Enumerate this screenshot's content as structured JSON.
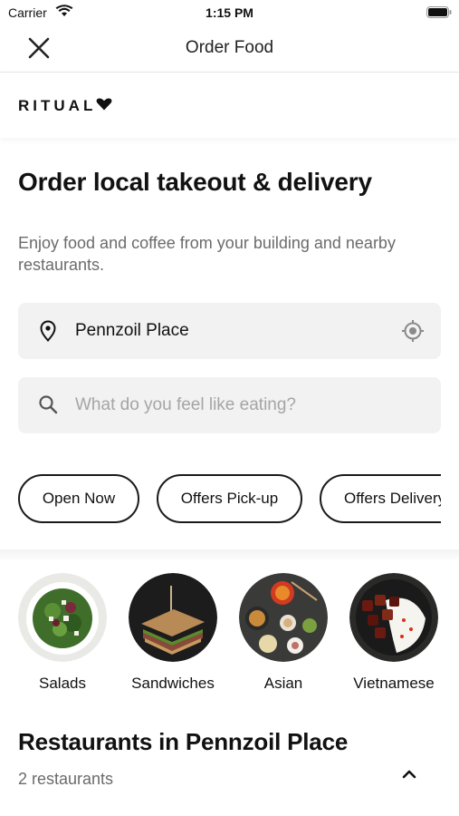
{
  "status_bar": {
    "carrier": "Carrier",
    "time": "1:15 PM"
  },
  "nav": {
    "title": "Order Food",
    "close_icon": "close-icon"
  },
  "brand": {
    "name": "RITUAL",
    "logo_icon": "heart-icon"
  },
  "hero": {
    "headline": "Order local takeout & delivery",
    "subtext": "Enjoy food and coffee from your building and nearby restaurants."
  },
  "location": {
    "value": "Pennzoil Place",
    "icon": "map-pin-icon",
    "action_icon": "locate-icon"
  },
  "search": {
    "placeholder": "What do you feel like eating?",
    "icon": "search-icon"
  },
  "filters": [
    {
      "label": "Open Now"
    },
    {
      "label": "Offers Pick-up"
    },
    {
      "label": "Offers Delivery"
    }
  ],
  "categories": [
    {
      "label": "Salads"
    },
    {
      "label": "Sandwiches"
    },
    {
      "label": "Asian"
    },
    {
      "label": "Vietnamese"
    }
  ],
  "restaurants": {
    "title": "Restaurants in Pennzoil Place",
    "count": "2 restaurants"
  },
  "colors": {
    "text": "#111111",
    "muted": "#6b6b6b",
    "field_bg": "#f2f2f2",
    "placeholder": "#a5a5a5"
  }
}
